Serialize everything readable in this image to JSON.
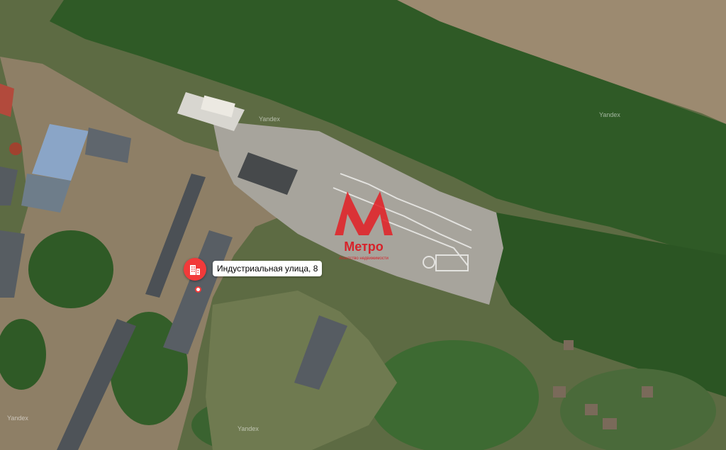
{
  "marker": {
    "address": "Индустриальная улица, 8",
    "icon": "building-icon",
    "color": "#f23a3a"
  },
  "logo": {
    "name": "Метро",
    "tagline": "Агентство недвижимости",
    "color": "#e31e24"
  },
  "watermark": "Yandex"
}
